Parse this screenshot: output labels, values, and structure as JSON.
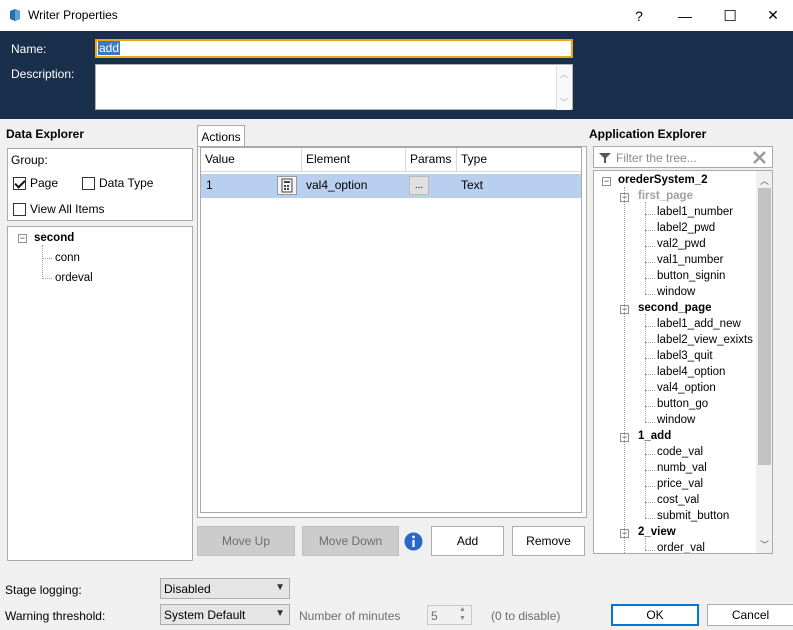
{
  "window": {
    "title": "Writer Properties",
    "help": "?",
    "minimize": "—",
    "maximize": "☐",
    "close": "✕"
  },
  "header": {
    "name_label": "Name:",
    "name_value": "add",
    "description_label": "Description:"
  },
  "data_explorer": {
    "title": "Data Explorer",
    "group_label": "Group:",
    "page_label": "Page",
    "page_checked": true,
    "data_type_label": "Data Type",
    "data_type_checked": false,
    "view_all_label": "View All Items",
    "view_all_checked": false,
    "tree": {
      "root": "second",
      "children": [
        "conn",
        "ordeval"
      ]
    }
  },
  "actions": {
    "tab_label": "Actions",
    "columns": [
      "Value",
      "Element",
      "Params",
      "Type"
    ],
    "rows": [
      {
        "value": "1",
        "element": "val4_option",
        "params": "...",
        "type": "Text"
      }
    ],
    "buttons": {
      "move_up": "Move Up",
      "move_down": "Move Down",
      "add": "Add",
      "remove": "Remove"
    }
  },
  "app_explorer": {
    "title": "Application Explorer",
    "filter_placeholder": "Filter the tree...",
    "root": "orederSystem_2",
    "nodes": [
      {
        "label": "first_page",
        "level": 1,
        "dim": true
      },
      {
        "label": "label1_number",
        "level": 2
      },
      {
        "label": "label2_pwd",
        "level": 2
      },
      {
        "label": "val2_pwd",
        "level": 2
      },
      {
        "label": "val1_number",
        "level": 2
      },
      {
        "label": "button_signin",
        "level": 2
      },
      {
        "label": "window",
        "level": 2
      },
      {
        "label": "second_page",
        "level": 1
      },
      {
        "label": "label1_add_new",
        "level": 2
      },
      {
        "label": "label2_view_exixts",
        "level": 2
      },
      {
        "label": "label3_quit",
        "level": 2
      },
      {
        "label": "label4_option",
        "level": 2
      },
      {
        "label": "val4_option",
        "level": 2
      },
      {
        "label": "button_go",
        "level": 2
      },
      {
        "label": "window",
        "level": 2
      },
      {
        "label": "1_add",
        "level": 1
      },
      {
        "label": "code_val",
        "level": 2
      },
      {
        "label": "numb_val",
        "level": 2
      },
      {
        "label": "price_val",
        "level": 2
      },
      {
        "label": "cost_val",
        "level": 2
      },
      {
        "label": "submit_button",
        "level": 2
      },
      {
        "label": "2_view",
        "level": 1
      },
      {
        "label": "order_val",
        "level": 2
      }
    ]
  },
  "footer": {
    "stage_logging_label": "Stage logging:",
    "stage_logging_value": "Disabled",
    "warning_label": "Warning threshold:",
    "warning_value": "System Default",
    "minutes_label": "Number of minutes",
    "minutes_value": "5",
    "disable_hint": "(0 to disable)",
    "ok": "OK",
    "cancel": "Cancel"
  },
  "colors": {
    "header_bg": "#1a2f4b",
    "name_border": "#e6a817",
    "selection": "#b8cff0",
    "accent": "#0078d7"
  }
}
